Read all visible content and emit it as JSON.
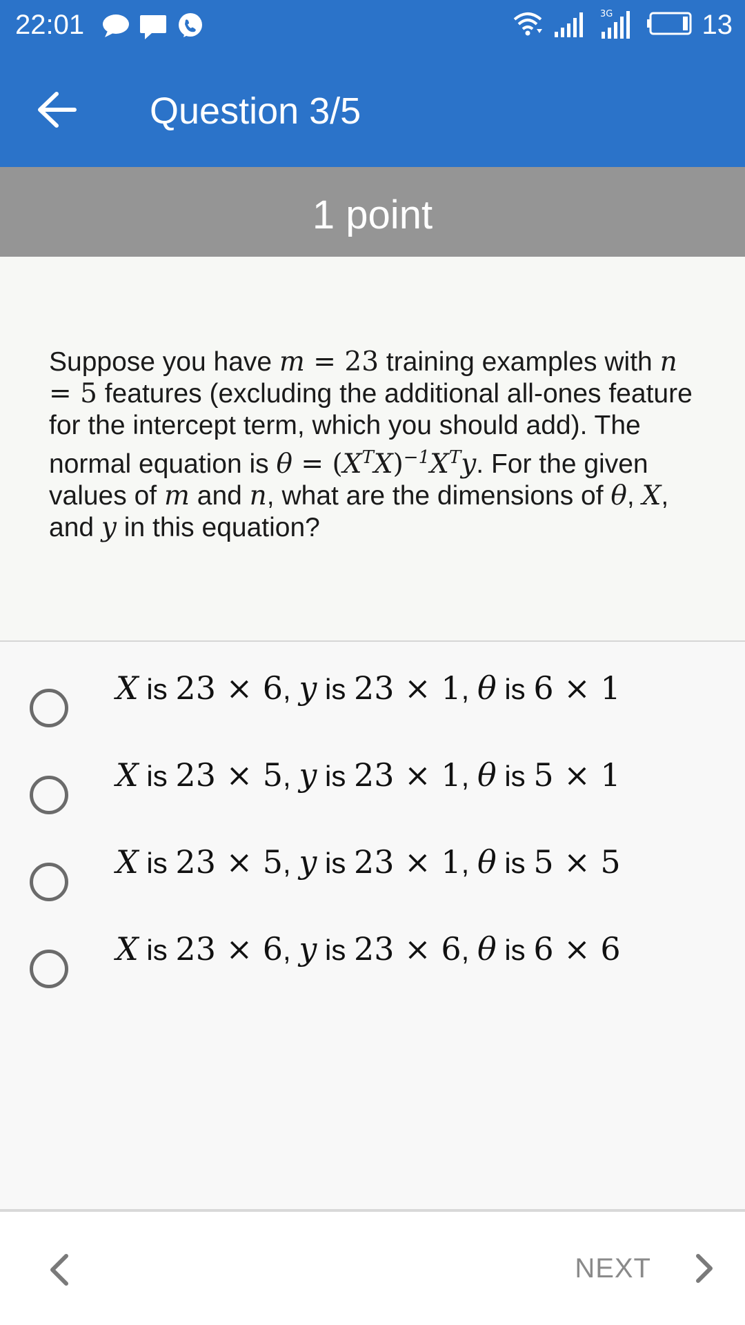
{
  "status_bar": {
    "time": "22:01",
    "battery_level": "13",
    "left_icons": [
      "chat-bubble-icon",
      "message-icon",
      "viber-icon"
    ],
    "right_icons": [
      "wifi-icon",
      "signal-icon",
      "signal-3g-icon",
      "battery-icon"
    ]
  },
  "header": {
    "back_icon": "arrow-left-icon",
    "title": "Question 3/5",
    "background": "#2b73c9"
  },
  "points": {
    "label": "1 point"
  },
  "question": {
    "segments": [
      {
        "text": "Suppose you have ",
        "kind": "text"
      },
      {
        "text": "m",
        "kind": "math"
      },
      {
        "text": " = ",
        "kind": "num"
      },
      {
        "text": "23",
        "kind": "num"
      },
      {
        "text": " training examples with ",
        "kind": "text"
      },
      {
        "text": "n",
        "kind": "math"
      },
      {
        "text": " = 5",
        "kind": "num"
      },
      {
        "text": " features (excluding the additional all-ones feature for the intercept term, which you should add). The normal equation is ",
        "kind": "text"
      },
      {
        "text": "θ",
        "kind": "math"
      },
      {
        "text": " = (",
        "kind": "num"
      },
      {
        "text": "X",
        "kind": "math"
      },
      {
        "text": "T",
        "kind": "sup"
      },
      {
        "text": "X",
        "kind": "math"
      },
      {
        "text": ")",
        "kind": "num"
      },
      {
        "text": "−1",
        "kind": "sup"
      },
      {
        "text": "X",
        "kind": "math"
      },
      {
        "text": "T",
        "kind": "sup"
      },
      {
        "text": "y",
        "kind": "math"
      },
      {
        "text": ". For the given values of ",
        "kind": "text"
      },
      {
        "text": "m",
        "kind": "math"
      },
      {
        "text": " and ",
        "kind": "text"
      },
      {
        "text": "n",
        "kind": "math"
      },
      {
        "text": ", what are the dimensions of ",
        "kind": "text"
      },
      {
        "text": "θ",
        "kind": "math"
      },
      {
        "text": ", ",
        "kind": "text"
      },
      {
        "text": "X",
        "kind": "math"
      },
      {
        "text": ", and ",
        "kind": "text"
      },
      {
        "text": "y",
        "kind": "math"
      },
      {
        "text": " in this equation?",
        "kind": "text"
      }
    ]
  },
  "options": [
    {
      "x": "23 × 6",
      "y": "23 × 1",
      "theta": "6 × 1",
      "selected": false
    },
    {
      "x": "23 × 5",
      "y": "23 × 1",
      "theta": "5 × 1",
      "selected": false
    },
    {
      "x": "23 × 5",
      "y": "23 × 1",
      "theta": "5 × 5",
      "selected": false
    },
    {
      "x": "23 × 6",
      "y": "23 × 6",
      "theta": "6 × 6",
      "selected": false
    }
  ],
  "option_words": {
    "var_x": "X",
    "var_y": "y",
    "var_theta": "θ",
    "is": " is ",
    "sep": ", "
  },
  "footer": {
    "prev_icon": "chevron-left-icon",
    "next_label": "NEXT",
    "next_icon": "chevron-right-icon"
  }
}
